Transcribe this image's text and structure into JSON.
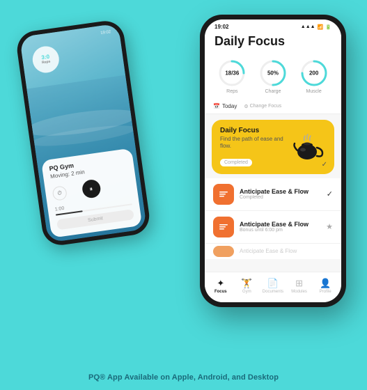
{
  "app": {
    "caption": "PQ® App Available on Apple, Android, and Desktop"
  },
  "back_phone": {
    "time": "19:02",
    "timer": {
      "value": "3:0",
      "label": "Reps"
    },
    "gym": "PQ Gym",
    "moving": "Moving: 2 min",
    "progress": "1:00",
    "submit": "Submit"
  },
  "front_phone": {
    "time": "19:02",
    "title": "Daily Focus",
    "stats": [
      {
        "value": "18/36",
        "label": "Reps"
      },
      {
        "value": "50%",
        "label": "Charge"
      },
      {
        "value": "200",
        "label": "Muscle"
      }
    ],
    "filter": {
      "today": "Today",
      "change": "Change Focus"
    },
    "focus_card": {
      "title": "Daily Focus",
      "subtitle": "Find the path of ease and flow.",
      "completed": "Completed"
    },
    "list_items": [
      {
        "title": "Anticipate Ease & Flow",
        "sub": "Completed",
        "action": "check"
      },
      {
        "title": "Anticipate Ease & Flow",
        "sub": "Bonus until 6:00 pm",
        "action": "star"
      }
    ],
    "nav": [
      {
        "label": "Focus",
        "active": true
      },
      {
        "label": "Gym",
        "active": false
      },
      {
        "label": "Documents",
        "active": false
      },
      {
        "label": "Modules",
        "active": false
      },
      {
        "label": "Profile",
        "active": false
      }
    ]
  }
}
